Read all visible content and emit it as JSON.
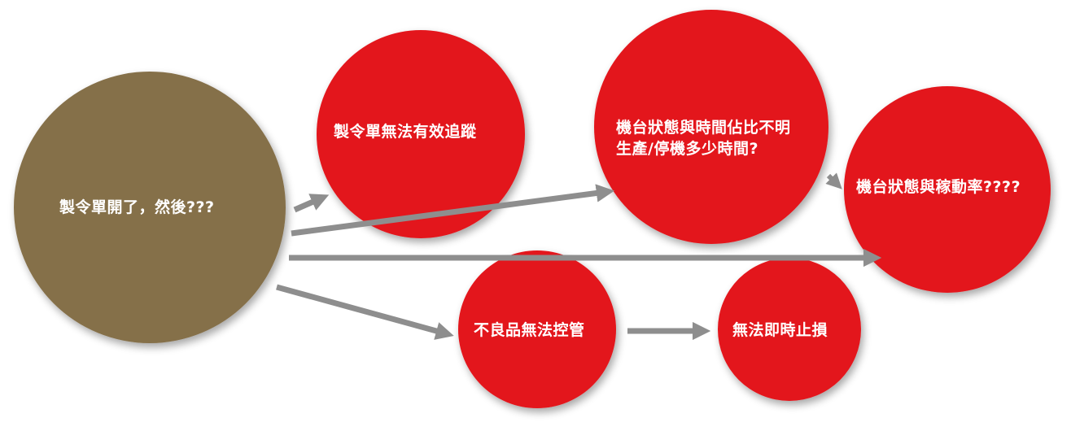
{
  "colors": {
    "start_node": "#856F4A",
    "problem_node": "#E3151B",
    "arrow": "#8E8E8E",
    "label": "#FFFFFF"
  },
  "nodes": {
    "start": {
      "label": "製令單開了，然後???"
    },
    "tracking": {
      "label": "製令單無法有效追蹤"
    },
    "machine_status": {
      "line1": "機台狀態與時間佔比不明",
      "line2": "生產/停機多少時間?"
    },
    "utilization": {
      "label": "機台狀態與稼動率????"
    },
    "defects": {
      "label": "不良品無法控管"
    },
    "loss": {
      "label": "無法即時止損"
    }
  }
}
